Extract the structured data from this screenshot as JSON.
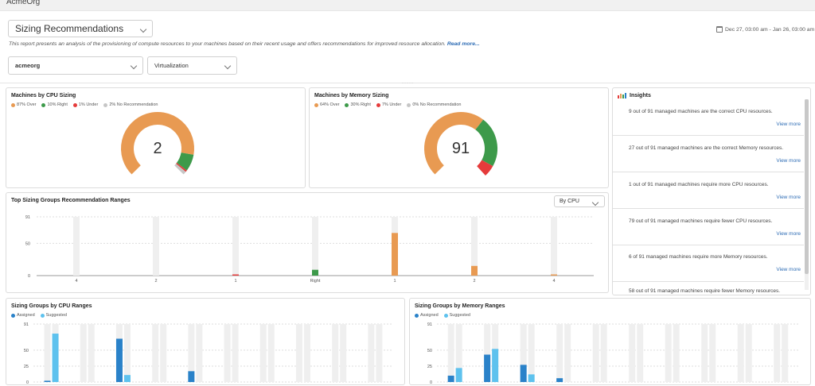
{
  "app": {
    "org_name": "AcmeOrg"
  },
  "report": {
    "selected": "Sizing Recommendations",
    "description": "This report presents an analysis of the provisioning of compute resources to your machines based on their recent usage and offers recommendations for improved resource allocation.",
    "read_more": "Read more...",
    "date_range": "Dec 27, 03:00 am - Jan 26, 03:00 am"
  },
  "filters": {
    "org": "acmeorg",
    "type": "Virtualization"
  },
  "colors": {
    "over": "#e89a52",
    "right": "#3d9a4a",
    "under": "#e53b3b",
    "none": "#c6c6c6",
    "assigned": "#2a82c9",
    "suggested": "#5ec2ee",
    "link": "#2f6db5"
  },
  "cpu_sizing": {
    "title": "Machines by CPU Sizing",
    "legend": [
      "87% Over",
      "10% Right",
      "1% Under",
      "2% No Recommendation"
    ],
    "center_value": "2",
    "fractions": [
      0.87,
      0.1,
      0.01,
      0.02
    ]
  },
  "memory_sizing": {
    "title": "Machines by Memory Sizing",
    "legend": [
      "64% Over",
      "30% Right",
      "7% Under",
      "0% No Recommendation"
    ],
    "center_value": "91",
    "fractions": [
      0.64,
      0.3,
      0.07,
      0.0
    ]
  },
  "insights": {
    "title": "Insights",
    "items": [
      {
        "text": "9 out of 91 managed machines are the correct CPU resources.",
        "more": "View more"
      },
      {
        "text": "27 out of 91 managed machines are the correct Memory resources.",
        "more": "View more"
      },
      {
        "text": "1 out of 91 managed machines require more CPU resources.",
        "more": "View more"
      },
      {
        "text": "79 out of 91 managed machines require fewer CPU resources.",
        "more": "View more"
      },
      {
        "text": "6 of 91 managed machines require more Memory resources.",
        "more": "View more"
      },
      {
        "text": "58 out of 91 managed machines require fewer Memory resources.",
        "more": ""
      }
    ]
  },
  "chart_data": [
    {
      "type": "bar",
      "title": "Top Sizing Groups Recommendation Ranges",
      "selector": "By CPU",
      "categories": [
        "4",
        "2",
        "1",
        "Right",
        "1",
        "2",
        "4"
      ],
      "values": [
        0,
        0,
        1,
        9,
        66,
        15,
        1
      ],
      "bar_colors": [
        "under",
        "under",
        "under",
        "right",
        "over",
        "over",
        "over"
      ],
      "yticks": [
        "91",
        "50",
        "0"
      ],
      "ylim": [
        0,
        91
      ],
      "grid": true
    },
    {
      "type": "bar",
      "title": "Sizing Groups by CPU Ranges",
      "legend": [
        "Assigned",
        "Suggested"
      ],
      "yticks": [
        "91",
        "50",
        "25",
        "0"
      ],
      "ylim": [
        0,
        91
      ],
      "series": [
        {
          "name": "Assigned",
          "values": [
            2,
            0,
            68,
            0,
            17,
            0,
            0,
            0,
            0,
            0
          ]
        },
        {
          "name": "Suggested",
          "values": [
            76,
            0,
            11,
            0,
            0,
            0,
            0,
            0,
            0,
            0
          ]
        }
      ]
    },
    {
      "type": "bar",
      "title": "Sizing Groups by Memory Ranges",
      "legend": [
        "Assigned",
        "Suggested"
      ],
      "yticks": [
        "91",
        "50",
        "25",
        "0"
      ],
      "ylim": [
        0,
        91
      ],
      "series": [
        {
          "name": "Assigned",
          "values": [
            10,
            43,
            27,
            6,
            0,
            0,
            0,
            0,
            0,
            0
          ]
        },
        {
          "name": "Suggested",
          "values": [
            22,
            52,
            12,
            0,
            0,
            0,
            0,
            0,
            0,
            0
          ]
        }
      ]
    }
  ]
}
